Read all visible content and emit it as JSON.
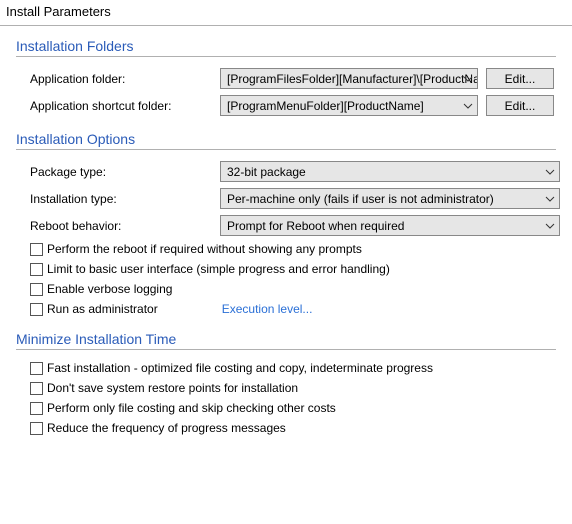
{
  "pageTitle": "Install Parameters",
  "sections": {
    "folders": {
      "title": "Installation Folders",
      "appFolderLabel": "Application folder:",
      "appFolderValue": "[ProgramFilesFolder][Manufacturer]\\[ProductName]",
      "appShortcutLabel": "Application shortcut folder:",
      "appShortcutValue": "[ProgramMenuFolder][ProductName]",
      "editBtn": "Edit..."
    },
    "options": {
      "title": "Installation Options",
      "packageTypeLabel": "Package type:",
      "packageTypeValue": "32-bit package",
      "installTypeLabel": "Installation type:",
      "installTypeValue": "Per-machine only (fails if user is not administrator)",
      "rebootLabel": "Reboot behavior:",
      "rebootValue": "Prompt for Reboot when required",
      "checks": {
        "reboot": "Perform the reboot if required without showing any prompts",
        "basicUi": "Limit to basic user interface (simple progress and error handling)",
        "verbose": "Enable verbose logging",
        "runAdmin": "Run as administrator"
      },
      "execLevelLink": "Execution level..."
    },
    "minimize": {
      "title": "Minimize Installation Time",
      "checks": {
        "fastInstall": "Fast installation - optimized file costing and copy, indeterminate progress",
        "noRestore": "Don't save system restore points for installation",
        "fileCosting": "Perform only file costing and skip checking other costs",
        "reduceProgress": "Reduce the frequency of progress messages"
      }
    }
  }
}
